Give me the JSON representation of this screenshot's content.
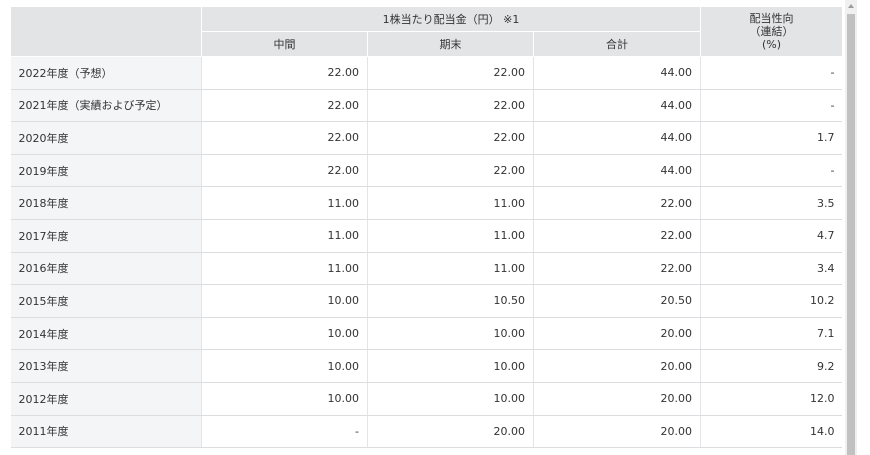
{
  "table": {
    "header_group": "1株当たり配当金（円） ※1",
    "columns": [
      "中間",
      "期末",
      "合計"
    ],
    "ratio_header": [
      "配当性向",
      "（連結）",
      "(%)"
    ],
    "rows": [
      {
        "year": "2022年度（予想）",
        "interim": "22.00",
        "year_end": "22.00",
        "total": "44.00",
        "ratio": "-"
      },
      {
        "year": "2021年度（実績および予定）",
        "interim": "22.00",
        "year_end": "22.00",
        "total": "44.00",
        "ratio": "-"
      },
      {
        "year": "2020年度",
        "interim": "22.00",
        "year_end": "22.00",
        "total": "44.00",
        "ratio": "1.7"
      },
      {
        "year": "2019年度",
        "interim": "22.00",
        "year_end": "22.00",
        "total": "44.00",
        "ratio": "-"
      },
      {
        "year": "2018年度",
        "interim": "11.00",
        "year_end": "11.00",
        "total": "22.00",
        "ratio": "3.5"
      },
      {
        "year": "2017年度",
        "interim": "11.00",
        "year_end": "11.00",
        "total": "22.00",
        "ratio": "4.7"
      },
      {
        "year": "2016年度",
        "interim": "11.00",
        "year_end": "11.00",
        "total": "22.00",
        "ratio": "3.4"
      },
      {
        "year": "2015年度",
        "interim": "10.00",
        "year_end": "10.50",
        "total": "20.50",
        "ratio": "10.2"
      },
      {
        "year": "2014年度",
        "interim": "10.00",
        "year_end": "10.00",
        "total": "20.00",
        "ratio": "7.1"
      },
      {
        "year": "2013年度",
        "interim": "10.00",
        "year_end": "10.00",
        "total": "20.00",
        "ratio": "9.2"
      },
      {
        "year": "2012年度",
        "interim": "10.00",
        "year_end": "10.00",
        "total": "20.00",
        "ratio": "12.0"
      },
      {
        "year": "2011年度",
        "interim": "-",
        "year_end": "20.00",
        "total": "20.00",
        "ratio": "14.0"
      }
    ]
  },
  "scrollbar": {
    "up_icon": "chevron-up-icon"
  }
}
